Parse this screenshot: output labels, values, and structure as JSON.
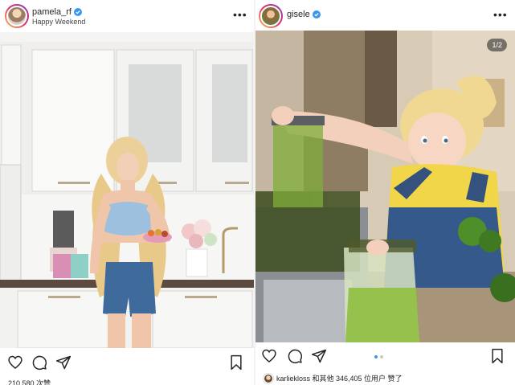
{
  "left_post": {
    "username": "pamela_rf",
    "location": "Happy Weekend",
    "more_label": "•••",
    "likes_text": "210,580 次赞",
    "icons": [
      "heart-icon",
      "comment-icon",
      "share-icon",
      "bookmark-icon"
    ]
  },
  "right_post": {
    "username": "gisele",
    "more_label": "•••",
    "slide_counter": "1/2",
    "carousel": {
      "total": 2,
      "active": 1
    },
    "likes_text": "karliekloss 和其他 346,405 位用户 赞了",
    "icons": [
      "heart-icon",
      "comment-icon",
      "share-icon",
      "bookmark-icon"
    ]
  },
  "colors": {
    "verified_blue": "#3897f0",
    "text": "#262626",
    "carousel_inactive": "#c7c7c7"
  }
}
